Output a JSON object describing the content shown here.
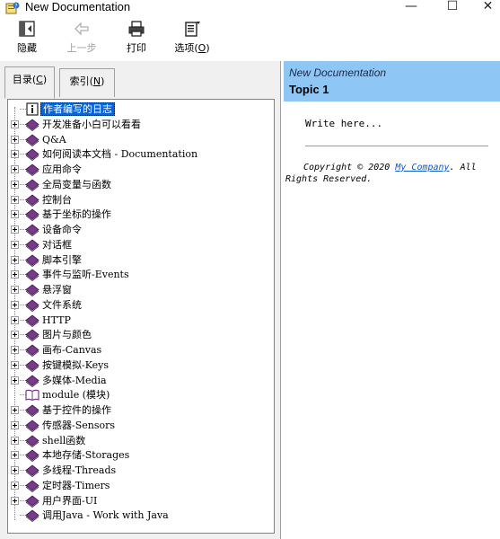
{
  "window": {
    "title": "New Documentation",
    "controls": {
      "minimize": "—",
      "maximize": "☐",
      "close": "✕"
    }
  },
  "toolbar": {
    "hide_label": "隐藏",
    "back_label": "上一步",
    "print_label": "打印",
    "options_label_prefix": "选项(",
    "options_label_key": "O",
    "options_label_suffix": ")",
    "back_disabled": true
  },
  "nav": {
    "tab_contents_prefix": "目录(",
    "tab_contents_key": "C",
    "tab_contents_suffix": ")",
    "tab_index_prefix": "索引(",
    "tab_index_key": "N",
    "tab_index_suffix": ")",
    "tree": [
      {
        "label": "作者编写的日志",
        "icon": "info-page-icon",
        "expandable": false,
        "selected": true
      },
      {
        "label": "开发准备小白可以看看",
        "icon": "book-icon",
        "expandable": true
      },
      {
        "label": "Q&A",
        "icon": "book-icon",
        "expandable": true
      },
      {
        "label": "如何阅读本文档 - Documentation",
        "icon": "book-icon",
        "expandable": true
      },
      {
        "label": "应用命令",
        "icon": "book-icon",
        "expandable": true
      },
      {
        "label": "全局变量与函数",
        "icon": "book-icon",
        "expandable": true
      },
      {
        "label": "控制台",
        "icon": "book-icon",
        "expandable": true
      },
      {
        "label": "基于坐标的操作",
        "icon": "book-icon",
        "expandable": true
      },
      {
        "label": "设备命令",
        "icon": "book-icon",
        "expandable": true
      },
      {
        "label": "对话框",
        "icon": "book-icon",
        "expandable": true
      },
      {
        "label": "脚本引擎",
        "icon": "book-icon",
        "expandable": true
      },
      {
        "label": "事件与监听-Events",
        "icon": "book-icon",
        "expandable": true
      },
      {
        "label": "悬浮窗",
        "icon": "book-icon",
        "expandable": true
      },
      {
        "label": "文件系统",
        "icon": "book-icon",
        "expandable": true
      },
      {
        "label": "HTTP",
        "icon": "book-icon",
        "expandable": true
      },
      {
        "label": "图片与颜色",
        "icon": "book-icon",
        "expandable": true
      },
      {
        "label": "画布-Canvas",
        "icon": "book-icon",
        "expandable": true
      },
      {
        "label": "按键模拟-Keys",
        "icon": "book-icon",
        "expandable": true
      },
      {
        "label": "多媒体-Media",
        "icon": "book-icon",
        "expandable": true
      },
      {
        "label": "module (模块)",
        "icon": "open-book-icon",
        "expandable": false
      },
      {
        "label": "基于控件的操作",
        "icon": "book-icon",
        "expandable": true
      },
      {
        "label": "传感器-Sensors",
        "icon": "book-icon",
        "expandable": true
      },
      {
        "label": "shell函数",
        "icon": "book-icon",
        "expandable": true
      },
      {
        "label": "本地存储-Storages",
        "icon": "book-icon",
        "expandable": true
      },
      {
        "label": "多线程-Threads",
        "icon": "book-icon",
        "expandable": true
      },
      {
        "label": "定时器-Timers",
        "icon": "book-icon",
        "expandable": true
      },
      {
        "label": "用户界面-UI",
        "icon": "book-icon",
        "expandable": true
      },
      {
        "label": "调用Java - Work with Java",
        "icon": "book-icon",
        "expandable": false
      }
    ]
  },
  "content": {
    "doc_title": "New Documentation",
    "topic_title": "Topic 1",
    "body_placeholder": "Write here...",
    "copyright_prefix": "Copyright © 2020 ",
    "copyright_link": "My Company",
    "copyright_suffix": ". All Rights Reserved."
  },
  "colors": {
    "header_bg": "#8ec7f5",
    "selection_bg": "#0a64d6",
    "book_purple": "#7a3a8c",
    "link_blue": "#0b57d0"
  }
}
